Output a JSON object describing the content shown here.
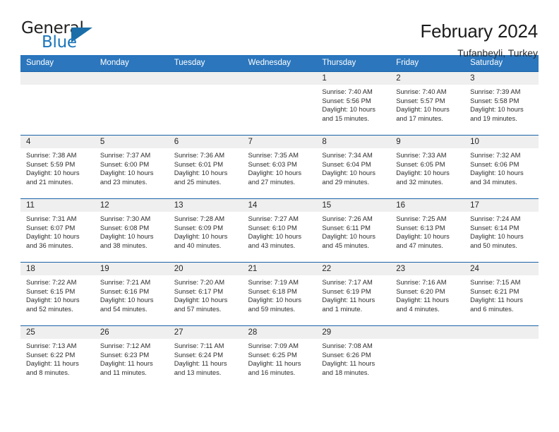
{
  "brand": {
    "name_top": "General",
    "name_bottom": "Blue",
    "accent_color": "#1b76bb",
    "triangle_color": "#1b6ea8"
  },
  "header": {
    "title": "February 2024",
    "subtitle": "Tufanbeyli, Turkey"
  },
  "theme": {
    "header_row_bg": "#2b76bd",
    "header_row_text": "#ffffff",
    "cell_border_top": "#1b63a8",
    "day_band_bg": "#efefef",
    "body_text": "#2d2d2d"
  },
  "labels": {
    "sunrise_prefix": "Sunrise:",
    "sunset_prefix": "Sunset:",
    "daylight_prefix": "Daylight:"
  },
  "weekdays": [
    "Sunday",
    "Monday",
    "Tuesday",
    "Wednesday",
    "Thursday",
    "Friday",
    "Saturday"
  ],
  "weeks": [
    [
      {
        "date": "",
        "empty": true,
        "sunrise": "",
        "sunset": "",
        "daylight_1": "",
        "daylight_2": ""
      },
      {
        "date": "",
        "empty": true,
        "sunrise": "",
        "sunset": "",
        "daylight_1": "",
        "daylight_2": ""
      },
      {
        "date": "",
        "empty": true,
        "sunrise": "",
        "sunset": "",
        "daylight_1": "",
        "daylight_2": ""
      },
      {
        "date": "",
        "empty": true,
        "sunrise": "",
        "sunset": "",
        "daylight_1": "",
        "daylight_2": ""
      },
      {
        "date": "1",
        "empty": false,
        "sunrise": "Sunrise: 7:40 AM",
        "sunset": "Sunset: 5:56 PM",
        "daylight_1": "Daylight: 10 hours",
        "daylight_2": "and 15 minutes."
      },
      {
        "date": "2",
        "empty": false,
        "sunrise": "Sunrise: 7:40 AM",
        "sunset": "Sunset: 5:57 PM",
        "daylight_1": "Daylight: 10 hours",
        "daylight_2": "and 17 minutes."
      },
      {
        "date": "3",
        "empty": false,
        "sunrise": "Sunrise: 7:39 AM",
        "sunset": "Sunset: 5:58 PM",
        "daylight_1": "Daylight: 10 hours",
        "daylight_2": "and 19 minutes."
      }
    ],
    [
      {
        "date": "4",
        "empty": false,
        "sunrise": "Sunrise: 7:38 AM",
        "sunset": "Sunset: 5:59 PM",
        "daylight_1": "Daylight: 10 hours",
        "daylight_2": "and 21 minutes."
      },
      {
        "date": "5",
        "empty": false,
        "sunrise": "Sunrise: 7:37 AM",
        "sunset": "Sunset: 6:00 PM",
        "daylight_1": "Daylight: 10 hours",
        "daylight_2": "and 23 minutes."
      },
      {
        "date": "6",
        "empty": false,
        "sunrise": "Sunrise: 7:36 AM",
        "sunset": "Sunset: 6:01 PM",
        "daylight_1": "Daylight: 10 hours",
        "daylight_2": "and 25 minutes."
      },
      {
        "date": "7",
        "empty": false,
        "sunrise": "Sunrise: 7:35 AM",
        "sunset": "Sunset: 6:03 PM",
        "daylight_1": "Daylight: 10 hours",
        "daylight_2": "and 27 minutes."
      },
      {
        "date": "8",
        "empty": false,
        "sunrise": "Sunrise: 7:34 AM",
        "sunset": "Sunset: 6:04 PM",
        "daylight_1": "Daylight: 10 hours",
        "daylight_2": "and 29 minutes."
      },
      {
        "date": "9",
        "empty": false,
        "sunrise": "Sunrise: 7:33 AM",
        "sunset": "Sunset: 6:05 PM",
        "daylight_1": "Daylight: 10 hours",
        "daylight_2": "and 32 minutes."
      },
      {
        "date": "10",
        "empty": false,
        "sunrise": "Sunrise: 7:32 AM",
        "sunset": "Sunset: 6:06 PM",
        "daylight_1": "Daylight: 10 hours",
        "daylight_2": "and 34 minutes."
      }
    ],
    [
      {
        "date": "11",
        "empty": false,
        "sunrise": "Sunrise: 7:31 AM",
        "sunset": "Sunset: 6:07 PM",
        "daylight_1": "Daylight: 10 hours",
        "daylight_2": "and 36 minutes."
      },
      {
        "date": "12",
        "empty": false,
        "sunrise": "Sunrise: 7:30 AM",
        "sunset": "Sunset: 6:08 PM",
        "daylight_1": "Daylight: 10 hours",
        "daylight_2": "and 38 minutes."
      },
      {
        "date": "13",
        "empty": false,
        "sunrise": "Sunrise: 7:28 AM",
        "sunset": "Sunset: 6:09 PM",
        "daylight_1": "Daylight: 10 hours",
        "daylight_2": "and 40 minutes."
      },
      {
        "date": "14",
        "empty": false,
        "sunrise": "Sunrise: 7:27 AM",
        "sunset": "Sunset: 6:10 PM",
        "daylight_1": "Daylight: 10 hours",
        "daylight_2": "and 43 minutes."
      },
      {
        "date": "15",
        "empty": false,
        "sunrise": "Sunrise: 7:26 AM",
        "sunset": "Sunset: 6:11 PM",
        "daylight_1": "Daylight: 10 hours",
        "daylight_2": "and 45 minutes."
      },
      {
        "date": "16",
        "empty": false,
        "sunrise": "Sunrise: 7:25 AM",
        "sunset": "Sunset: 6:13 PM",
        "daylight_1": "Daylight: 10 hours",
        "daylight_2": "and 47 minutes."
      },
      {
        "date": "17",
        "empty": false,
        "sunrise": "Sunrise: 7:24 AM",
        "sunset": "Sunset: 6:14 PM",
        "daylight_1": "Daylight: 10 hours",
        "daylight_2": "and 50 minutes."
      }
    ],
    [
      {
        "date": "18",
        "empty": false,
        "sunrise": "Sunrise: 7:22 AM",
        "sunset": "Sunset: 6:15 PM",
        "daylight_1": "Daylight: 10 hours",
        "daylight_2": "and 52 minutes."
      },
      {
        "date": "19",
        "empty": false,
        "sunrise": "Sunrise: 7:21 AM",
        "sunset": "Sunset: 6:16 PM",
        "daylight_1": "Daylight: 10 hours",
        "daylight_2": "and 54 minutes."
      },
      {
        "date": "20",
        "empty": false,
        "sunrise": "Sunrise: 7:20 AM",
        "sunset": "Sunset: 6:17 PM",
        "daylight_1": "Daylight: 10 hours",
        "daylight_2": "and 57 minutes."
      },
      {
        "date": "21",
        "empty": false,
        "sunrise": "Sunrise: 7:19 AM",
        "sunset": "Sunset: 6:18 PM",
        "daylight_1": "Daylight: 10 hours",
        "daylight_2": "and 59 minutes."
      },
      {
        "date": "22",
        "empty": false,
        "sunrise": "Sunrise: 7:17 AM",
        "sunset": "Sunset: 6:19 PM",
        "daylight_1": "Daylight: 11 hours",
        "daylight_2": "and 1 minute."
      },
      {
        "date": "23",
        "empty": false,
        "sunrise": "Sunrise: 7:16 AM",
        "sunset": "Sunset: 6:20 PM",
        "daylight_1": "Daylight: 11 hours",
        "daylight_2": "and 4 minutes."
      },
      {
        "date": "24",
        "empty": false,
        "sunrise": "Sunrise: 7:15 AM",
        "sunset": "Sunset: 6:21 PM",
        "daylight_1": "Daylight: 11 hours",
        "daylight_2": "and 6 minutes."
      }
    ],
    [
      {
        "date": "25",
        "empty": false,
        "sunrise": "Sunrise: 7:13 AM",
        "sunset": "Sunset: 6:22 PM",
        "daylight_1": "Daylight: 11 hours",
        "daylight_2": "and 8 minutes."
      },
      {
        "date": "26",
        "empty": false,
        "sunrise": "Sunrise: 7:12 AM",
        "sunset": "Sunset: 6:23 PM",
        "daylight_1": "Daylight: 11 hours",
        "daylight_2": "and 11 minutes."
      },
      {
        "date": "27",
        "empty": false,
        "sunrise": "Sunrise: 7:11 AM",
        "sunset": "Sunset: 6:24 PM",
        "daylight_1": "Daylight: 11 hours",
        "daylight_2": "and 13 minutes."
      },
      {
        "date": "28",
        "empty": false,
        "sunrise": "Sunrise: 7:09 AM",
        "sunset": "Sunset: 6:25 PM",
        "daylight_1": "Daylight: 11 hours",
        "daylight_2": "and 16 minutes."
      },
      {
        "date": "29",
        "empty": false,
        "sunrise": "Sunrise: 7:08 AM",
        "sunset": "Sunset: 6:26 PM",
        "daylight_1": "Daylight: 11 hours",
        "daylight_2": "and 18 minutes."
      },
      {
        "date": "",
        "empty": true,
        "sunrise": "",
        "sunset": "",
        "daylight_1": "",
        "daylight_2": ""
      },
      {
        "date": "",
        "empty": true,
        "sunrise": "",
        "sunset": "",
        "daylight_1": "",
        "daylight_2": ""
      }
    ]
  ]
}
